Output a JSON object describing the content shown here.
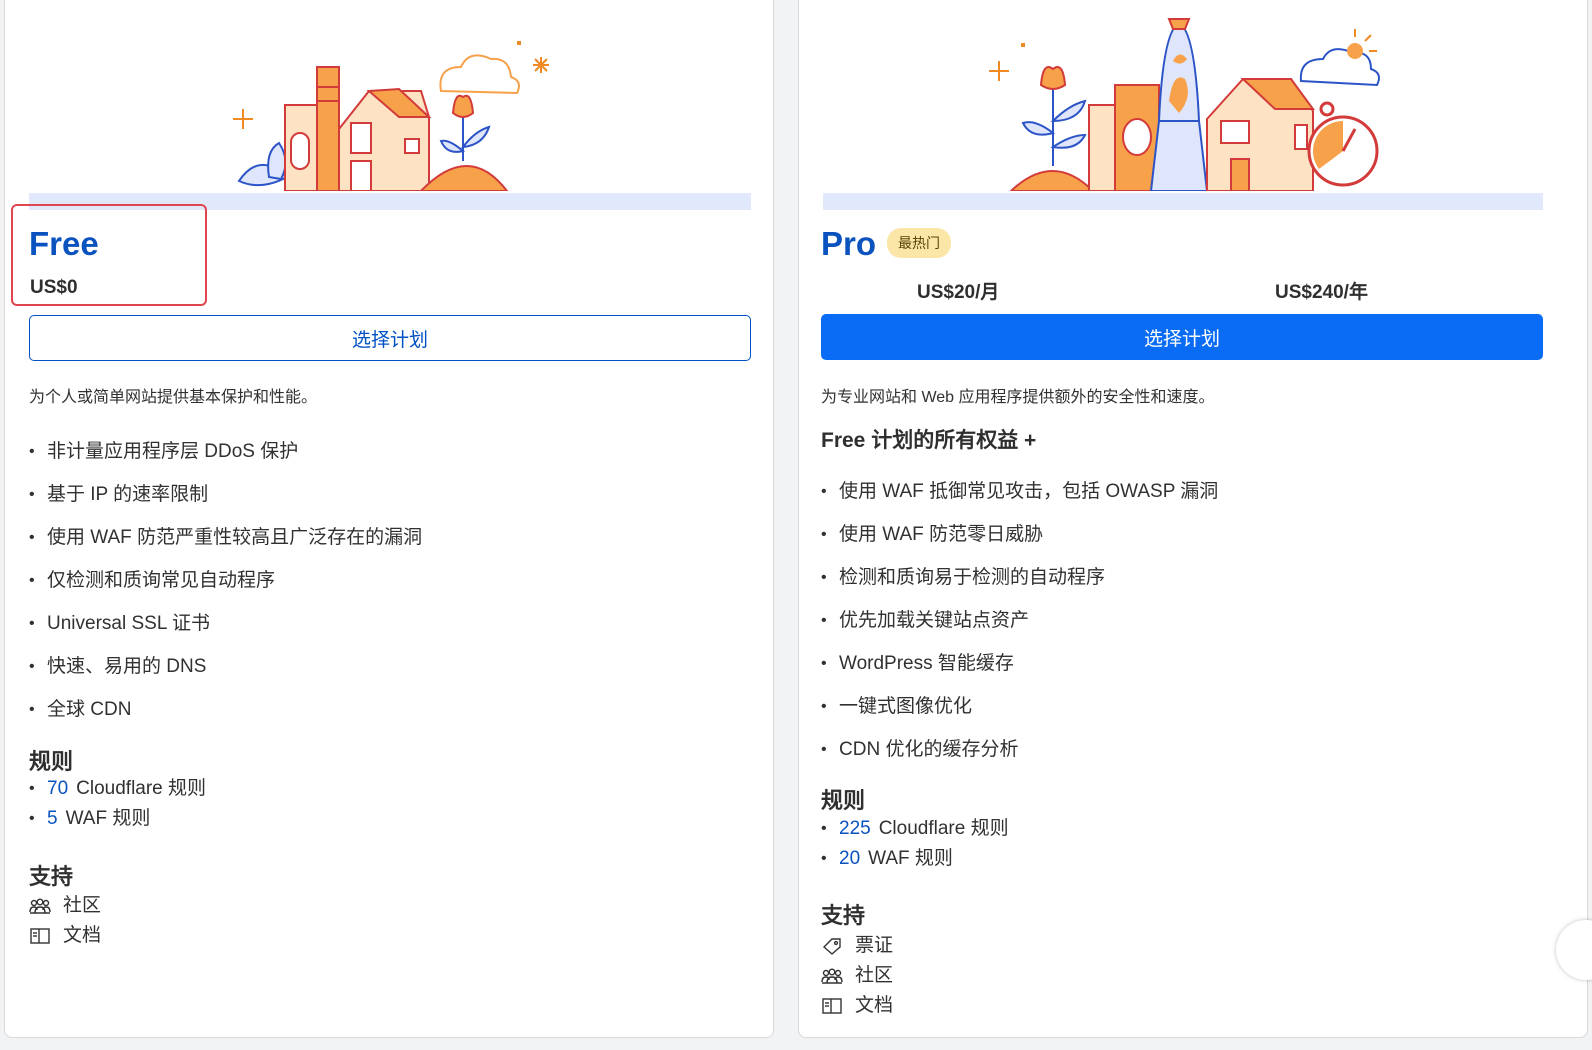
{
  "plans": {
    "free": {
      "name": "Free",
      "price": "US$0",
      "button_label": "选择计划",
      "description": "为个人或简单网站提供基本保护和性能。",
      "features": [
        "非计量应用程序层 DDoS 保护",
        "基于 IP 的速率限制",
        "使用 WAF 防范严重性较高且广泛存在的漏洞",
        "仅检测和质询常见自动程序",
        "Universal SSL 证书",
        "快速、易用的 DNS",
        "全球 CDN"
      ],
      "rules_title": "规则",
      "rules": [
        {
          "count": "70",
          "label": "Cloudflare 规则"
        },
        {
          "count": "5",
          "label": "WAF 规则"
        }
      ],
      "support_title": "支持",
      "support": [
        {
          "icon": "community-icon",
          "label": "社区"
        },
        {
          "icon": "docs-book-icon",
          "label": "文档"
        }
      ]
    },
    "pro": {
      "name": "Pro",
      "badge": "最热门",
      "price_monthly": "US$20/月",
      "price_yearly": "US$240/年",
      "button_label": "选择计划",
      "description": "为专业网站和 Web 应用程序提供额外的安全性和速度。",
      "includes": "Free 计划的所有权益 +",
      "features": [
        "使用 WAF 抵御常见攻击，包括 OWASP 漏洞",
        "使用 WAF 防范零日威胁",
        "检测和质询易于检测的自动程序",
        "优先加载关键站点资产",
        "WordPress 智能缓存",
        "一键式图像优化",
        "CDN 优化的缓存分析"
      ],
      "rules_title": "规则",
      "rules": [
        {
          "count": "225",
          "label": "Cloudflare 规则"
        },
        {
          "count": "20",
          "label": "WAF 规则"
        }
      ],
      "support_title": "支持",
      "support": [
        {
          "icon": "ticket-icon",
          "label": "票证"
        },
        {
          "icon": "community-icon",
          "label": "社区"
        },
        {
          "icon": "docs-book-icon",
          "label": "文档"
        }
      ]
    }
  },
  "colors": {
    "brand_blue": "#0a53bf",
    "button_blue": "#0a6cf5",
    "highlight_red": "#e0464f",
    "badge_bg": "#fbe6a8"
  }
}
